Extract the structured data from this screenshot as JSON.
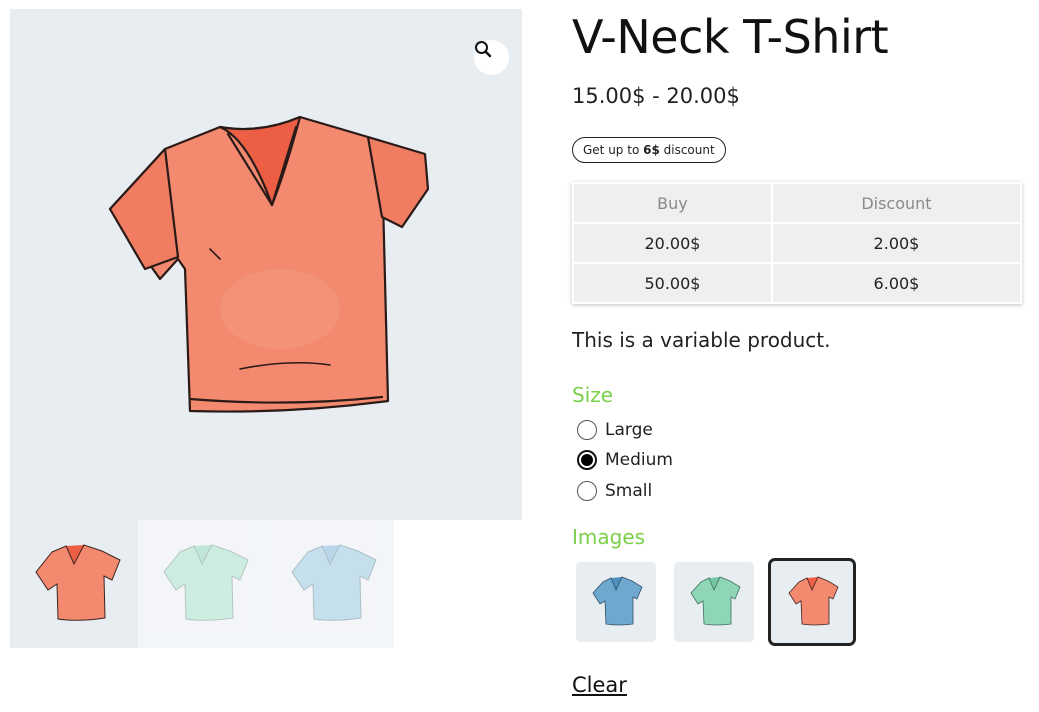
{
  "product": {
    "title": "V-Neck T-Shirt",
    "price_range": "15.00$ - 20.00$",
    "discount_badge": {
      "prefix": "Get up to ",
      "amount": "6$",
      "suffix": " discount"
    },
    "description": "This is a variable product."
  },
  "gallery": {
    "zoom_icon": "magnifier-icon",
    "main_image_color": "#f38a6f",
    "thumbnails": [
      {
        "name": "coral",
        "color": "#f38a6f",
        "active": true
      },
      {
        "name": "mint",
        "color": "#9cdcc4",
        "active": false
      },
      {
        "name": "blue",
        "color": "#8cc0dc",
        "active": false
      }
    ]
  },
  "discount_table": {
    "headers": [
      "Buy",
      "Discount"
    ],
    "rows": [
      [
        "20.00$",
        "2.00$"
      ],
      [
        "50.00$",
        "6.00$"
      ]
    ]
  },
  "attributes": {
    "size": {
      "label": "Size",
      "options": [
        "Large",
        "Medium",
        "Small"
      ],
      "selected": "Medium"
    },
    "images": {
      "label": "Images",
      "swatches": [
        {
          "name": "blue",
          "color": "#6fa8cf"
        },
        {
          "name": "mint",
          "color": "#8fd6b6"
        },
        {
          "name": "coral",
          "color": "#f38a6f"
        }
      ],
      "selected": "coral"
    }
  },
  "actions": {
    "clear_label": "Clear"
  },
  "colors": {
    "attribute_label": "#7ad04a",
    "image_background": "#e8edf2"
  }
}
